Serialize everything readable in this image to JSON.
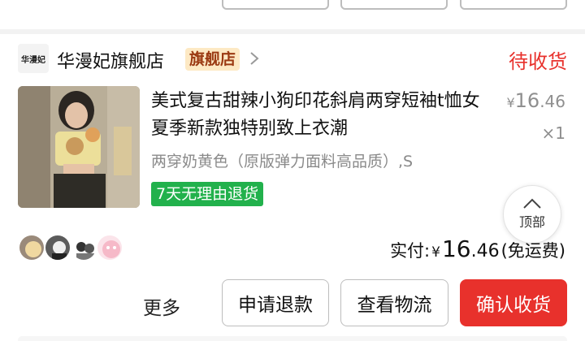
{
  "shop": {
    "logo_text": "华漫妃",
    "name": "华漫妃旗舰店",
    "badge": "旗舰店",
    "status": "待收货"
  },
  "product": {
    "title": "美式复古甜辣小狗印花斜肩两穿短袖t恤女夏季新款独特别致上衣潮",
    "spec": "两穿奶黄色（原版弹力面料高品质）,S",
    "return_badge": "7天无理由退货",
    "price_currency": "¥",
    "price_int": "16",
    "price_dec": ".46",
    "quantity": "×1"
  },
  "back_to_top": {
    "label": "顶部",
    "icon": "chevron-up-icon"
  },
  "payment": {
    "label": "实付:",
    "currency": "¥",
    "amount_int": "16",
    "amount_dec": ".46",
    "shipping_note": "(免运费)"
  },
  "actions": {
    "more": "更多",
    "refund": "申请退款",
    "logistics": "查看物流",
    "confirm": "确认收货"
  },
  "colors": {
    "accent_red": "#e8312c",
    "return_green": "#22b14c",
    "badge_bg": "#fde9c4",
    "badge_text": "#9b3a12"
  }
}
